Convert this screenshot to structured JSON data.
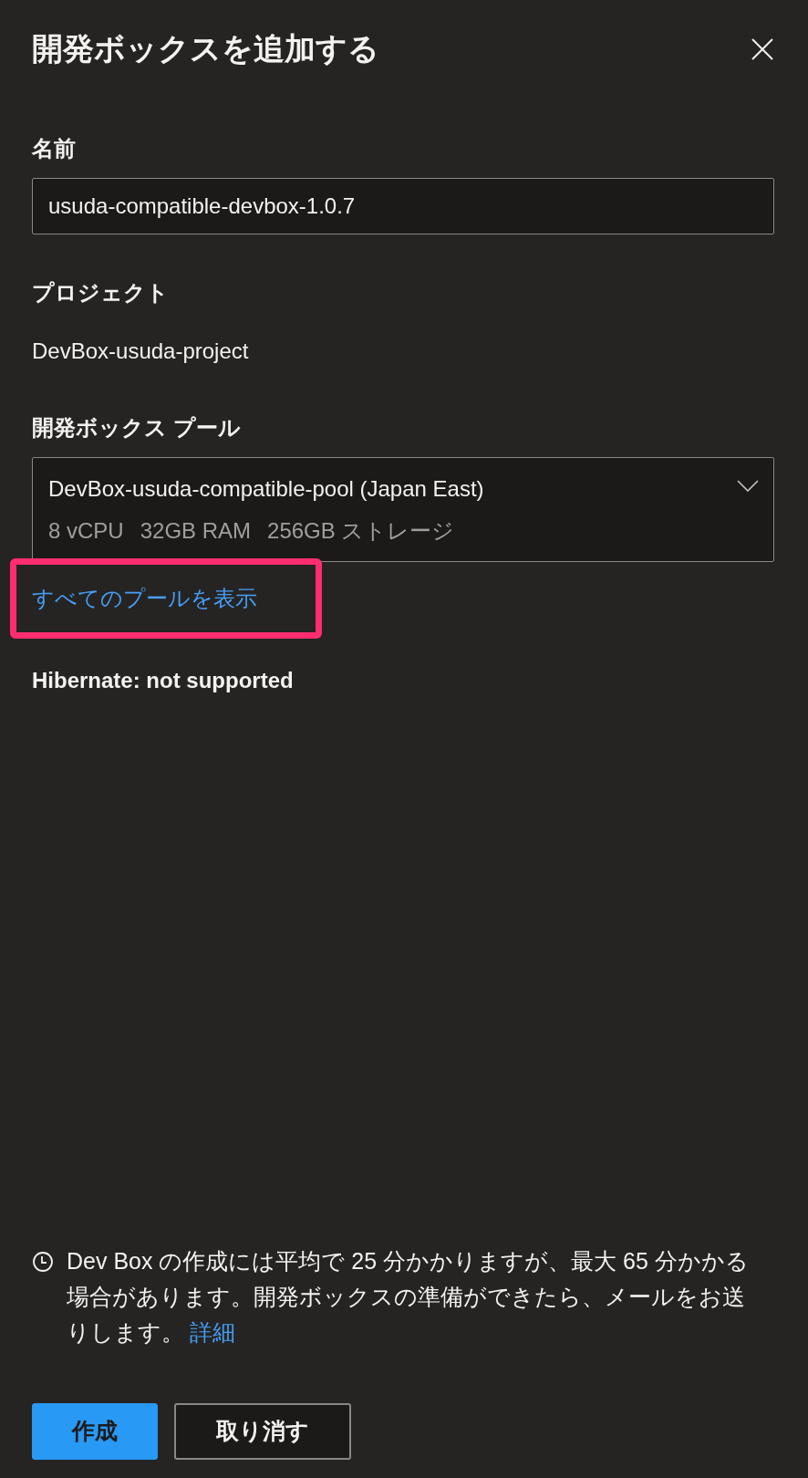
{
  "panel": {
    "title": "開発ボックスを追加する"
  },
  "name_field": {
    "label": "名前",
    "value": "usuda-compatible-devbox-1.0.7"
  },
  "project": {
    "label": "プロジェクト",
    "value": "DevBox-usuda-project"
  },
  "pool": {
    "label": "開発ボックス プール",
    "selected_name": "DevBox-usuda-compatible-pool (Japan East)",
    "specs": [
      "8 vCPU",
      "32GB RAM",
      "256GB ストレージ"
    ],
    "link": "すべてのプールを表示",
    "highlighted": true
  },
  "hibernate": "Hibernate: not supported",
  "notice": {
    "text": "Dev Box の作成には平均で 25 分かかりますが、最大 65 分かかる場合があります。開発ボックスの準備ができたら、メールをお送りします。",
    "link": "詳細"
  },
  "buttons": [
    {
      "label": "作成",
      "kind": "primary"
    },
    {
      "label": "取り消す",
      "kind": "secondary"
    }
  ]
}
